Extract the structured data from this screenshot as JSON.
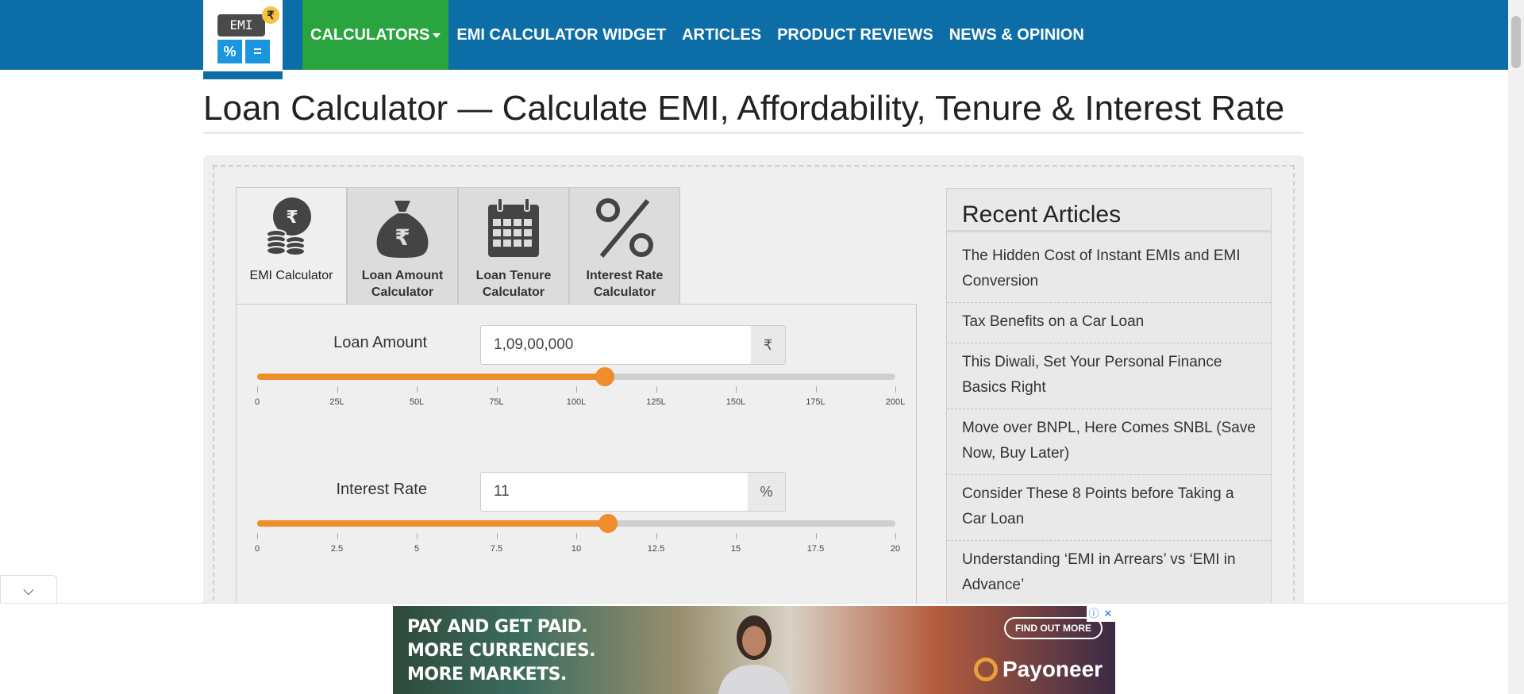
{
  "header": {
    "logo": {
      "screen_text": "EMI",
      "key1": "%",
      "key2": "=",
      "coin": "₹"
    },
    "nav": [
      {
        "label": "CALCULATORS",
        "active": true
      },
      {
        "label": "EMI CALCULATOR WIDGET"
      },
      {
        "label": "ARTICLES"
      },
      {
        "label": "PRODUCT REVIEWS"
      },
      {
        "label": "NEWS & OPINION"
      }
    ]
  },
  "page": {
    "title": "Loan Calculator — Calculate EMI, Affordability, Tenure & Interest Rate"
  },
  "tabs": [
    {
      "label": "EMI Calculator",
      "icon": "coins-icon",
      "active": true
    },
    {
      "label": "Loan Amount Calculator",
      "icon": "money-bag-icon"
    },
    {
      "label": "Loan Tenure Calculator",
      "icon": "calendar-icon"
    },
    {
      "label": "Interest Rate Calculator",
      "icon": "percent-icon"
    }
  ],
  "loan_amount": {
    "label": "Loan Amount",
    "value": "1,09,00,000",
    "unit": "₹",
    "slider_level": 0.545,
    "ticks": [
      "0",
      "25L",
      "50L",
      "75L",
      "100L",
      "125L",
      "150L",
      "175L",
      "200L"
    ]
  },
  "interest_rate": {
    "label": "Interest Rate",
    "value": "11",
    "unit": "%",
    "slider_level": 0.55,
    "ticks": [
      "0",
      "2.5",
      "5",
      "7.5",
      "10",
      "12.5",
      "15",
      "17.5",
      "20"
    ]
  },
  "sidebar": {
    "title": "Recent Articles",
    "articles": [
      "The Hidden Cost of Instant EMIs and EMI Conversion",
      "Tax Benefits on a Car Loan",
      "This Diwali, Set Your Personal Finance Basics Right",
      "Move over BNPL, Here Comes SNBL (Save Now, Buy Later)",
      "Consider These 8 Points before Taking a Car Loan",
      "Understanding ‘EMI in Arrears’ vs ‘EMI in Advance’"
    ]
  },
  "ad": {
    "line1": "PAY AND GET PAID.",
    "line2": "MORE CURRENCIES.",
    "line3": "MORE MARKETS.",
    "cta": "FIND OUT MORE",
    "brand": "Payoneer",
    "info": "ⓘ",
    "close": "✕"
  },
  "collapse_icon": "⌵"
}
